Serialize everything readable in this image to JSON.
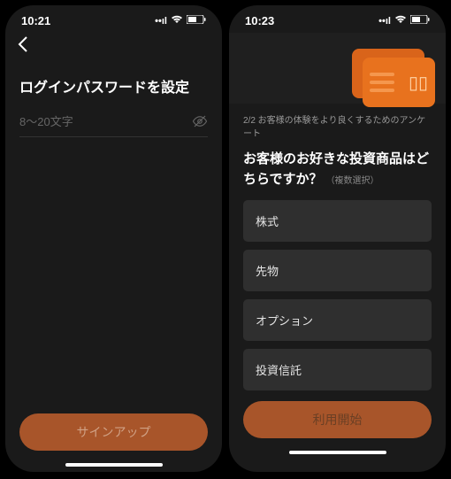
{
  "colors": {
    "accent": "#a8552a",
    "accent_dim": "#6a3f24",
    "bg": "#1a1a1a"
  },
  "left": {
    "time": "10:21",
    "signal": "••ll",
    "title": "ログインパスワードを設定",
    "input": {
      "placeholder": "8〜20文字",
      "value": ""
    },
    "button": "サインアップ"
  },
  "right": {
    "time": "10:23",
    "signal": "••ll",
    "crumb": "2/2 お客様の体験をより良くするためのアンケート",
    "question": "お客様のお好きな投資商品はどちらですか？",
    "sub": "（複数選択）",
    "options": [
      "株式",
      "先物",
      "オプション",
      "投資信託"
    ],
    "button": "利用開始"
  }
}
